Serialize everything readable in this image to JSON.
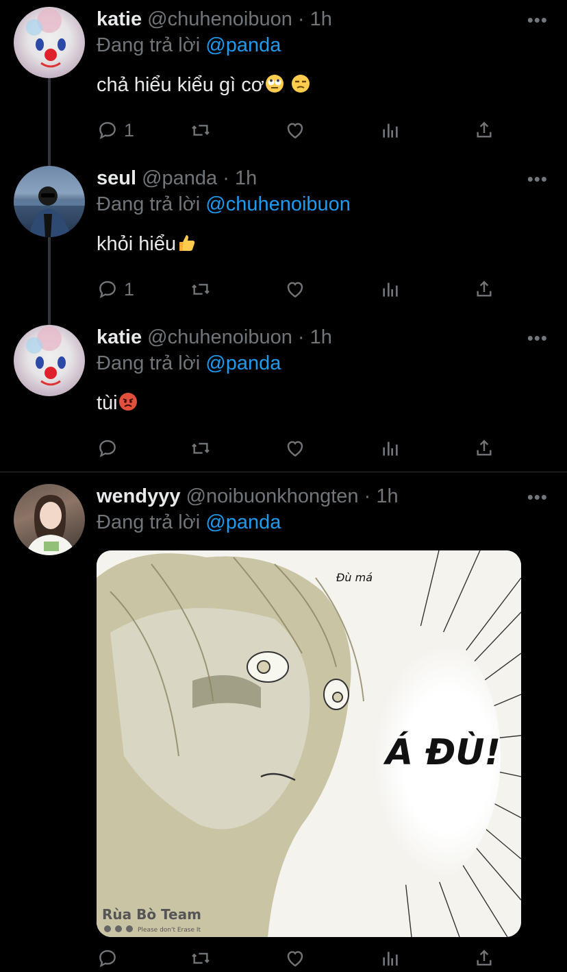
{
  "reply_prefix": "Đang trả lời",
  "tweets": [
    {
      "name": "katie",
      "handle": "@chuhenoibuon",
      "time": "· 1h",
      "reply_to": "@panda",
      "text": "chả hiểu kiểu gì cơ",
      "emojis": [
        "face-with-rolling-eyes",
        "unamused-face"
      ],
      "reply_count": "1"
    },
    {
      "name": "seul",
      "handle": "@panda",
      "time": "· 1h",
      "reply_to": "@chuhenoibuon",
      "text": "khỏi hiểu",
      "emojis": [
        "thumbs-up"
      ],
      "reply_count": "1"
    },
    {
      "name": "katie",
      "handle": "@chuhenoibuon",
      "time": "· 1h",
      "reply_to": "@panda",
      "text": "tùi",
      "emojis": [
        "pouting-face"
      ],
      "reply_count": ""
    },
    {
      "name": "wendyyy",
      "handle": "@noibuonkhongten",
      "time": "· 1h",
      "reply_to": "@panda",
      "text": "",
      "reply_count": ""
    }
  ],
  "more_label": "•••",
  "media": {
    "speech_small": "Đù má",
    "speech_big": "Á ĐÙ!",
    "watermark": "Rùa Bò Team",
    "watermark_sub": "Please don't Erase It"
  },
  "colors": {
    "background": "#000000",
    "text": "#e7e9ea",
    "muted": "#71767b",
    "link": "#1d9bf0"
  }
}
